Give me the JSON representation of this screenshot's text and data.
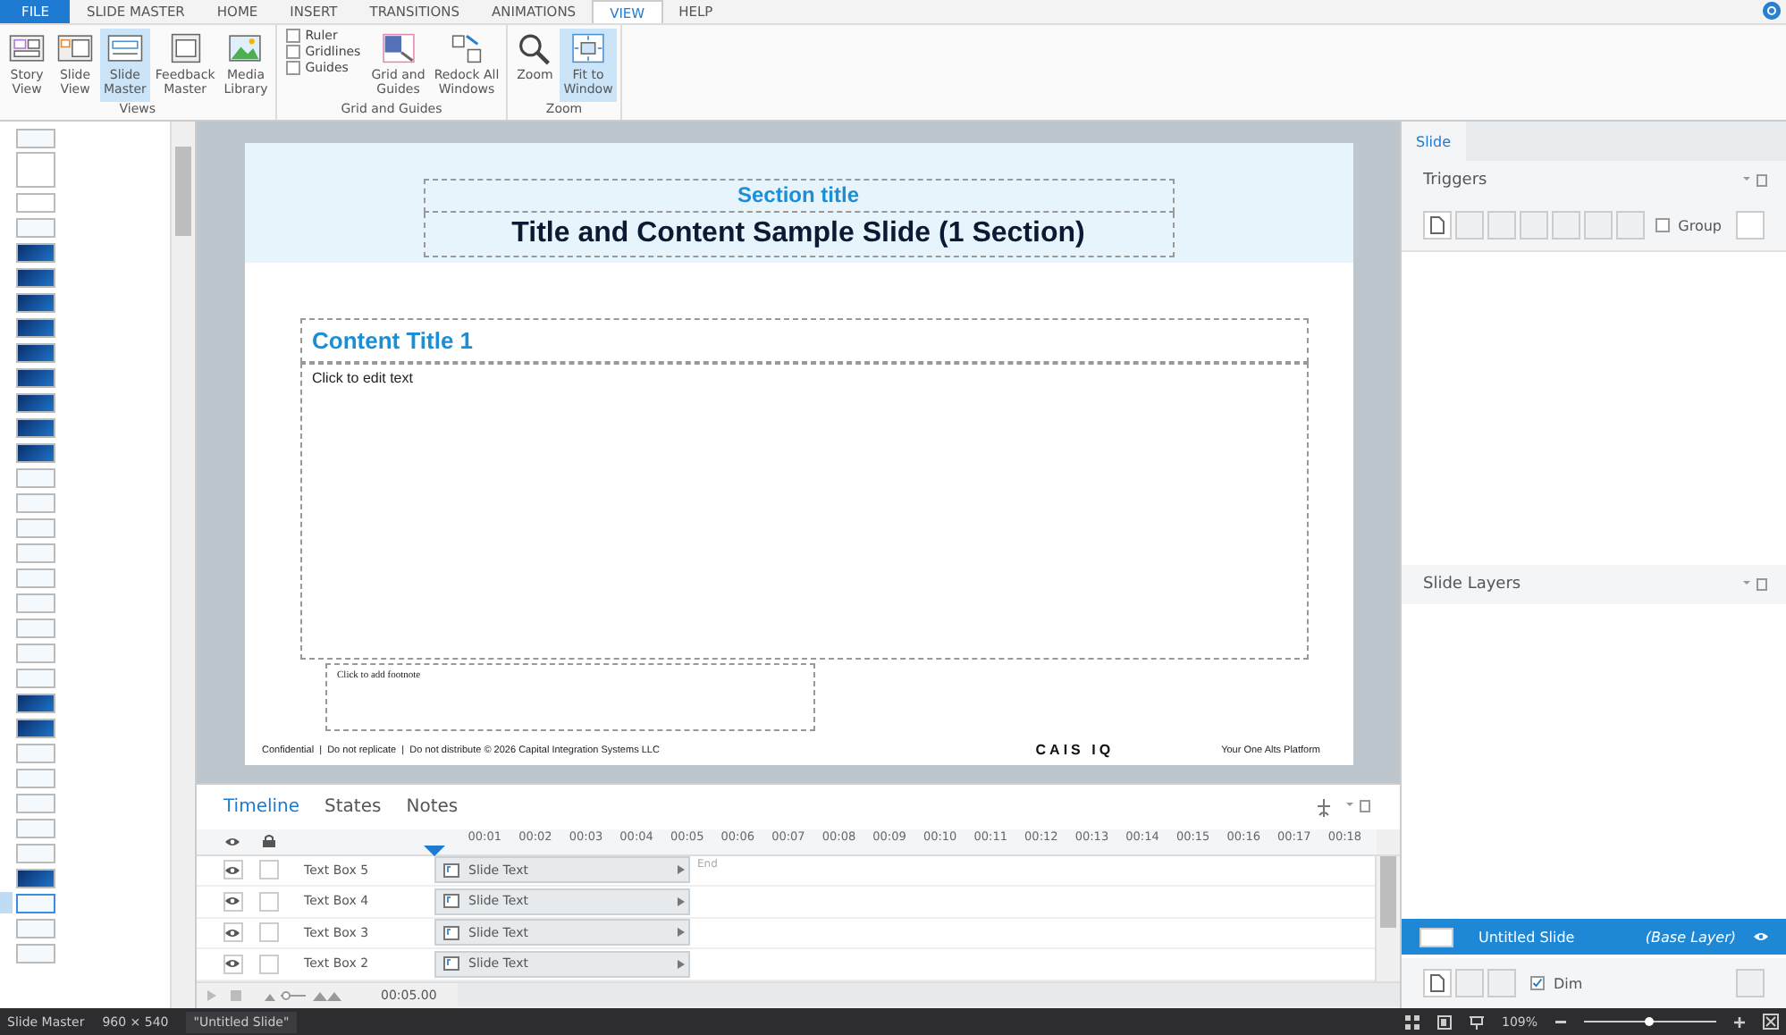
{
  "ribbon": {
    "tabs": [
      {
        "label": "FILE",
        "kind": "file",
        "selected": false
      },
      {
        "label": "SLIDE MASTER",
        "kind": "tab",
        "selected": false
      },
      {
        "label": "HOME",
        "kind": "tab",
        "selected": false
      },
      {
        "label": "INSERT",
        "kind": "tab",
        "selected": false
      },
      {
        "label": "TRANSITIONS",
        "kind": "tab",
        "selected": false
      },
      {
        "label": "ANIMATIONS",
        "kind": "tab",
        "selected": false
      },
      {
        "label": "VIEW",
        "kind": "tab",
        "selected": true
      },
      {
        "label": "HELP",
        "kind": "tab",
        "selected": false
      }
    ],
    "groups": [
      {
        "title": "Views",
        "items": [
          {
            "kind": "button",
            "lines": [
              "Story",
              "View"
            ],
            "selected": false
          },
          {
            "kind": "button",
            "lines": [
              "Slide",
              "View"
            ],
            "selected": false
          },
          {
            "kind": "button",
            "lines": [
              "Slide",
              "Master"
            ],
            "selected": true
          },
          {
            "kind": "button",
            "lines": [
              "Feedback",
              "Master"
            ],
            "selected": false
          },
          {
            "kind": "button",
            "lines": [
              "Media",
              "Library"
            ],
            "selected": false
          }
        ]
      },
      {
        "title": "Grid and Guides",
        "items": [
          {
            "kind": "checks",
            "checks": [
              {
                "label": "Ruler",
                "checked": false
              },
              {
                "label": "Gridlines",
                "checked": false
              },
              {
                "label": "Guides",
                "checked": false
              }
            ]
          },
          {
            "kind": "button",
            "lines": [
              "Grid and",
              "Guides"
            ],
            "selected": false
          },
          {
            "kind": "button",
            "lines": [
              "Redock All",
              "Windows"
            ],
            "selected": false
          }
        ]
      },
      {
        "title": "Zoom",
        "items": [
          {
            "kind": "button",
            "lines": [
              "Zoom"
            ],
            "selected": false
          },
          {
            "kind": "button",
            "lines": [
              "Fit to",
              "Window"
            ],
            "selected": true
          }
        ]
      }
    ]
  },
  "thumbnails": [
    {
      "kind": "light",
      "selected": false
    },
    {
      "kind": "tall",
      "selected": false
    },
    {
      "kind": "blank",
      "selected": false
    },
    {
      "kind": "light",
      "selected": false
    },
    {
      "kind": "dark",
      "selected": false
    },
    {
      "kind": "dark",
      "selected": false
    },
    {
      "kind": "dark",
      "selected": false
    },
    {
      "kind": "dark",
      "selected": false
    },
    {
      "kind": "dark",
      "selected": false
    },
    {
      "kind": "dark",
      "selected": false
    },
    {
      "kind": "dark",
      "selected": false
    },
    {
      "kind": "dark",
      "selected": false
    },
    {
      "kind": "dark",
      "selected": false
    },
    {
      "kind": "light",
      "selected": false
    },
    {
      "kind": "light",
      "selected": false
    },
    {
      "kind": "light",
      "selected": false
    },
    {
      "kind": "light",
      "selected": false
    },
    {
      "kind": "light",
      "selected": false
    },
    {
      "kind": "light",
      "selected": false
    },
    {
      "kind": "light",
      "selected": false
    },
    {
      "kind": "light",
      "selected": false
    },
    {
      "kind": "light",
      "selected": false
    },
    {
      "kind": "dark",
      "selected": false
    },
    {
      "kind": "dark",
      "selected": false
    },
    {
      "kind": "light",
      "selected": false
    },
    {
      "kind": "light",
      "selected": false
    },
    {
      "kind": "light",
      "selected": false
    },
    {
      "kind": "light",
      "selected": false
    },
    {
      "kind": "light",
      "selected": false
    },
    {
      "kind": "dark",
      "selected": false
    },
    {
      "kind": "light",
      "selected": true
    },
    {
      "kind": "light",
      "selected": false
    },
    {
      "kind": "light",
      "selected": false
    }
  ],
  "slide": {
    "section_title": "Section title",
    "title": "Title and Content Sample Slide (1 Section)",
    "content_title": "Content Title 1",
    "body_placeholder": "Click to edit text",
    "footnote_placeholder": "Click to add footnote",
    "footer": "Confidential  |  Do not replicate  |  Do not distribute © 2026 Capital Integration Systems LLC",
    "logo": "CAIS IQ",
    "tagline": "Your One Alts Platform"
  },
  "timeline": {
    "tabs": [
      {
        "label": "Timeline",
        "selected": true
      },
      {
        "label": "States",
        "selected": false
      },
      {
        "label": "Notes",
        "selected": false
      }
    ],
    "ticks": [
      "00:01",
      "00:02",
      "00:03",
      "00:04",
      "00:05",
      "00:06",
      "00:07",
      "00:08",
      "00:09",
      "00:10",
      "00:11",
      "00:12",
      "00:13",
      "00:14",
      "00:15",
      "00:16",
      "00:17",
      "00:18"
    ],
    "end_label": "End",
    "rows": [
      {
        "name": "Text Box 5",
        "bar": "Slide Text"
      },
      {
        "name": "Text Box 4",
        "bar": "Slide Text"
      },
      {
        "name": "Text Box 3",
        "bar": "Slide Text"
      },
      {
        "name": "Text Box 2",
        "bar": "Slide Text"
      }
    ],
    "duration": "00:05.00"
  },
  "right_panel": {
    "tab": "Slide",
    "triggers": {
      "title": "Triggers",
      "group": {
        "label": "Group",
        "checked": false
      }
    },
    "layers": {
      "title": "Slide Layers",
      "items": [
        {
          "name": "Untitled Slide",
          "note": "(Base Layer)",
          "selected": true
        }
      ],
      "dim": {
        "label": "Dim",
        "checked": true
      }
    }
  },
  "status_bar": {
    "mode": "Slide Master",
    "size": "960 × 540",
    "slide": "\"Untitled Slide\"",
    "zoom": "109%",
    "zoom_slider": {
      "level": 0.48
    }
  }
}
